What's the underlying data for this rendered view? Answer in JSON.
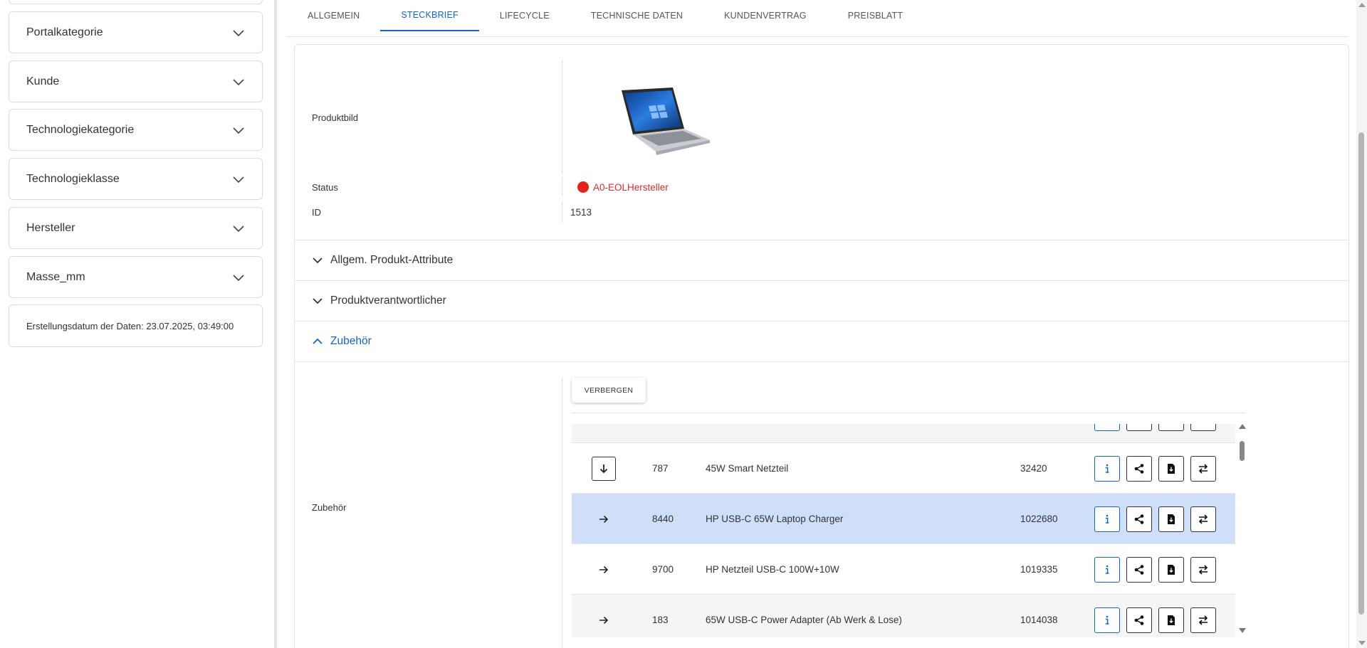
{
  "sidebar": {
    "filters": [
      {
        "label": "Portalkategorie"
      },
      {
        "label": "Kunde"
      },
      {
        "label": "Technologiekategorie"
      },
      {
        "label": "Technologieklasse"
      },
      {
        "label": "Hersteller"
      },
      {
        "label": "Masse_mm"
      }
    ],
    "creation_date": "Erstellungsdatum der Daten: 23.07.2025, 03:49:00"
  },
  "tabs": [
    {
      "label": "ALLGEMEIN"
    },
    {
      "label": "STECKBRIEF"
    },
    {
      "label": "LIFECYCLE"
    },
    {
      "label": "TECHNISCHE DATEN"
    },
    {
      "label": "KUNDENVERTRAG"
    },
    {
      "label": "PREISBLATT"
    }
  ],
  "active_tab": "STECKBRIEF",
  "details": {
    "image_label": "Produktbild",
    "status_label": "Status",
    "status_value": "A0-EOLHersteller",
    "status_color": "#e2231a",
    "id_label": "ID",
    "id_value": "1513"
  },
  "accordions": {
    "attributes": "Allgem. Produkt-Attribute",
    "responsible": "Produktverantwortlicher",
    "accessories": "Zubehör"
  },
  "accessories": {
    "row_label": "Zubehör",
    "hide_button": "VERBERGEN",
    "rows": [
      {
        "id": "787",
        "name": "45W Smart Netzteil",
        "number": "32420"
      },
      {
        "id": "8440",
        "name": "HP USB-C 65W Laptop Charger",
        "number": "1022680"
      },
      {
        "id": "9700",
        "name": "HP Netzteil USB-C 100W+10W",
        "number": "1019335"
      },
      {
        "id": "183",
        "name": "65W USB-C Power Adapter (Ab Werk & Lose)",
        "number": "1014038"
      }
    ]
  },
  "colors": {
    "accent": "#1565c0",
    "selected_row": "#cfdff9"
  }
}
